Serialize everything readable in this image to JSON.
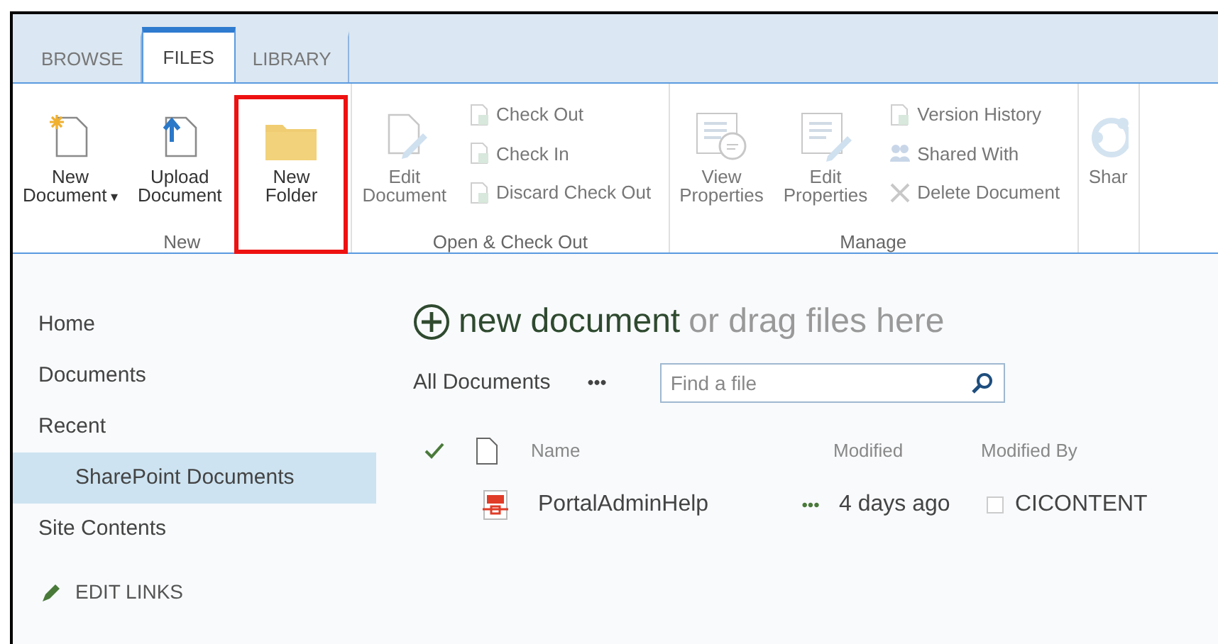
{
  "tabs": [
    {
      "label": "BROWSE",
      "selected": false
    },
    {
      "label": "FILES",
      "selected": true
    },
    {
      "label": "LIBRARY",
      "selected": false
    }
  ],
  "ribbon": [
    {
      "label": "New",
      "items": [
        {
          "kind": "large",
          "lines": [
            "New",
            "Document"
          ],
          "dropdown_mark": "▾",
          "disabled": false,
          "highlighted": false
        },
        {
          "kind": "large",
          "lines": [
            "Upload",
            "Document"
          ],
          "disabled": false,
          "highlighted": false
        },
        {
          "kind": "large",
          "lines": [
            "New",
            "Folder"
          ],
          "disabled": false,
          "highlighted": true
        }
      ]
    },
    {
      "label": "Open & Check Out",
      "items": [
        {
          "kind": "large",
          "lines": [
            "Edit",
            "Document"
          ],
          "disabled": true,
          "highlighted": false
        },
        {
          "kind": "stack",
          "buttons": [
            {
              "label": "Check Out",
              "disabled": true
            },
            {
              "label": "Check In",
              "disabled": true
            },
            {
              "label": "Discard Check Out",
              "disabled": true
            }
          ]
        }
      ]
    },
    {
      "label": "Manage",
      "items": [
        {
          "kind": "large",
          "lines": [
            "View",
            "Properties"
          ],
          "disabled": true,
          "highlighted": false
        },
        {
          "kind": "large",
          "lines": [
            "Edit",
            "Properties"
          ],
          "disabled": true,
          "highlighted": false
        },
        {
          "kind": "stack",
          "buttons": [
            {
              "label": "Version History",
              "disabled": true
            },
            {
              "label": "Shared With",
              "disabled": true
            },
            {
              "label": "Delete Document",
              "disabled": true
            }
          ]
        }
      ]
    },
    {
      "items": [
        {
          "kind": "large",
          "lines": [
            "Shar"
          ],
          "disabled": true,
          "highlighted": false
        }
      ]
    }
  ],
  "sidebar": {
    "items": [
      {
        "label": "Home",
        "selected": false
      },
      {
        "label": "Documents",
        "selected": false
      },
      {
        "label": "Recent",
        "selected": false,
        "children": [
          {
            "label": "SharePoint Documents",
            "selected": true
          }
        ]
      },
      {
        "label": "Site Contents",
        "selected": false
      }
    ],
    "edit_links": "EDIT LINKS"
  },
  "heading": {
    "action": "new document",
    "rest": "or drag files here"
  },
  "view": {
    "label": "All Documents",
    "more": "•••",
    "search": {
      "placeholder": "Find a file"
    }
  },
  "table": {
    "columns": [
      "Name",
      "Modified",
      "Modified By"
    ],
    "rows": [
      {
        "name": "PortalAdminHelp",
        "more": "•••",
        "modified": "4 days ago",
        "modified_by": "CICONTENT",
        "checked": false
      }
    ]
  }
}
